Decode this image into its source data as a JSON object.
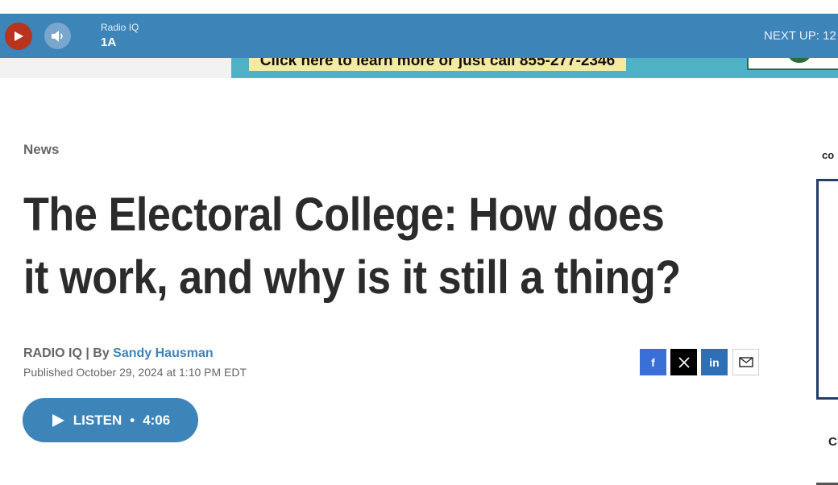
{
  "player": {
    "station": "Radio IQ",
    "program": "1A",
    "next_up": "NEXT UP: 12",
    "icons": {
      "play": "play-icon",
      "volume": "volume-icon"
    },
    "colors": {
      "bar": "#3d84b9",
      "play_button": "#b8341f"
    }
  },
  "ad": {
    "text": "Click here to learn more or just call 855-277-2346"
  },
  "article": {
    "category": "News",
    "title": "The Electoral College: How does it work, and why is it still a thing?",
    "byline_prefix": "RADIO IQ | By ",
    "author": "Sandy Hausman",
    "published": "Published October 29, 2024 at 1:10 PM EDT"
  },
  "share": {
    "facebook_label": "f",
    "linkedin_label": "in",
    "icons": [
      "facebook-icon",
      "x-icon",
      "linkedin-icon",
      "email-icon"
    ]
  },
  "listen": {
    "label": "LISTEN",
    "separator": "•",
    "duration": "4:06"
  },
  "sidebar": {
    "top_label": "co",
    "bottom_label": "Cl"
  }
}
